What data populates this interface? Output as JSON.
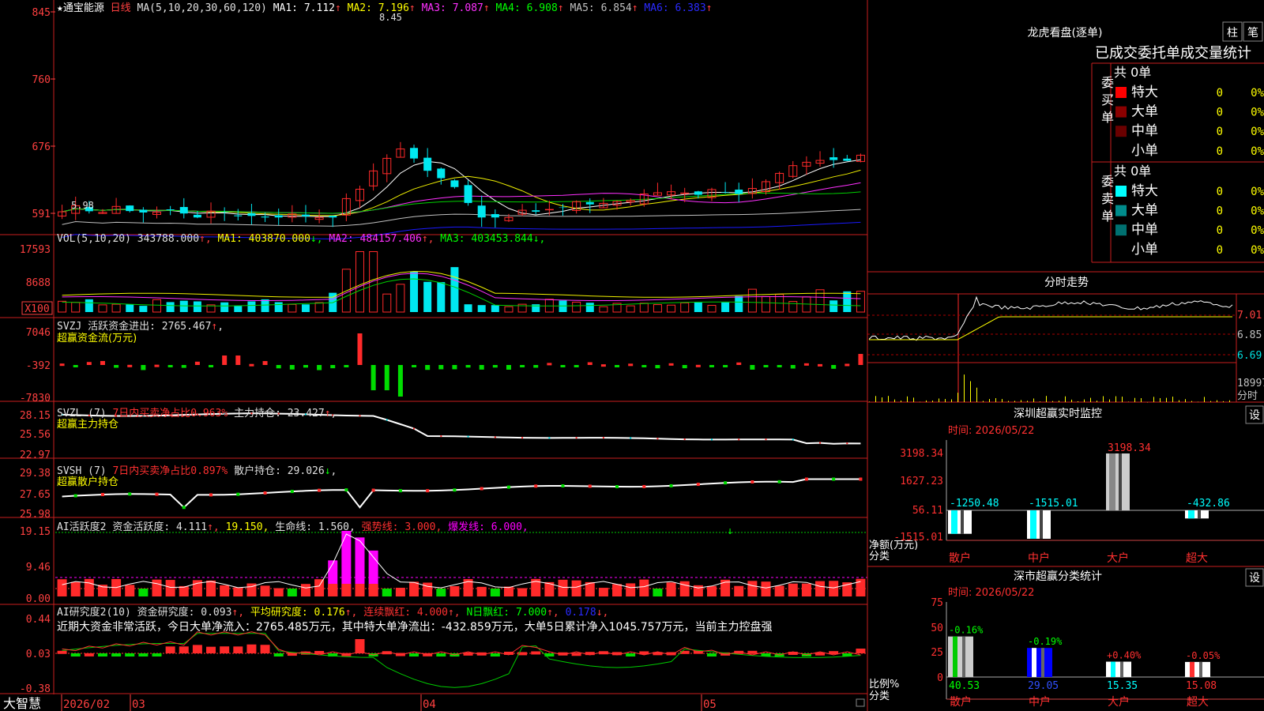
{
  "stock": {
    "star": "★",
    "name": "通宝能源",
    "period": "日线"
  },
  "colors": {
    "up": "#ff2a2a",
    "down": "#00e8f0",
    "axis_red": "#c81e1e",
    "ma1": "#ffffff",
    "ma2": "#f0f000",
    "ma3": "#ff30ff",
    "ma4": "#00d000",
    "ma5": "#c0c0c0",
    "ma6": "#1a1aff",
    "label_red": "#ff4040",
    "label_green": "#00ff00",
    "text_yellow": "#ffff00",
    "magenta": "#ff00ff"
  },
  "kline": {
    "header": {
      "ma_def": "MA(5,10,20,30,60,120)",
      "items": [
        {
          "label": "MA1: 7.112",
          "arrow": "↑",
          "color": "#ffffff"
        },
        {
          "label": "MA2: 7.196",
          "arrow": "↑",
          "color": "#ffff00"
        },
        {
          "label": "MA3: 7.087",
          "arrow": "↑",
          "color": "#ff30ff"
        },
        {
          "label": "MA4: 6.908",
          "arrow": "↑",
          "color": "#00ff00"
        },
        {
          "label": "MA5: 6.854",
          "arrow": "↑",
          "color": "#c0c0c0"
        },
        {
          "label": "MA6: 6.383",
          "arrow": "↑",
          "color": "#2a2aff"
        }
      ]
    },
    "axis_labels": [
      "845",
      "760",
      "676",
      "591"
    ],
    "annot_high": "8.45",
    "annot_low": "5.98"
  },
  "volume": {
    "header": {
      "def": "VOL(5,10,20)",
      "value": "343788.000",
      "value_arrow": "↑",
      "items": [
        {
          "label": "MA1: 403870.000",
          "arrow": "↓",
          "color": "#ffff00"
        },
        {
          "label": "MA2: 484157.406",
          "arrow": "↑",
          "color": "#ff30ff"
        },
        {
          "label": "MA3: 403453.844",
          "arrow": "↓",
          "color": "#00ff00"
        }
      ]
    },
    "axis_labels": [
      "17593",
      "8688"
    ],
    "unit": "X100"
  },
  "svzj": {
    "title": "SVZJ",
    "label": "活跃资金进出: 2765.467",
    "arrow": "↑",
    "suffix": ",",
    "subtitle": "超赢资金流(万元)",
    "axis_labels": [
      "7046",
      "-392",
      "-7830"
    ]
  },
  "svzl": {
    "title": "SVZL (7)",
    "note": "7日内买卖净占比0.963%",
    "label": "主力持仓: 23.427",
    "arrow": "↑",
    "suffix": ",",
    "subtitle": "超赢主力持仓",
    "axis_labels": [
      "28.15",
      "25.56",
      "22.97"
    ]
  },
  "svsh": {
    "title": "SVSH (7)",
    "note": "7日内买卖净占比0.897%",
    "label": "散户持仓: 29.026",
    "arrow": "↓",
    "suffix": ",",
    "subtitle": "超赢散户持仓",
    "axis_labels": [
      "29.38",
      "27.65",
      "25.98"
    ]
  },
  "ai_active": {
    "title": "AI活跃度2",
    "items": [
      {
        "label": "资金活跃度: 4.111",
        "arrow": "↑",
        "color": "#e0e0e0"
      },
      {
        "label": "19.150",
        "arrow": "",
        "color": "#ffff00"
      },
      {
        "label": "生命线: 1.560",
        "arrow": "",
        "color": "#e0e0e0"
      },
      {
        "label": "强势线: 3.000",
        "arrow": "",
        "color": "#ff3030"
      },
      {
        "label": "爆发线: 6.000",
        "arrow": "",
        "color": "#ff00ff"
      }
    ],
    "axis_labels": [
      "19.15",
      "9.46",
      "0.00"
    ]
  },
  "ai_research": {
    "title": "AI研究度2(10)",
    "items": [
      {
        "label": "资金研究度: 0.093",
        "arrow": "↑",
        "color": "#e0e0e0"
      },
      {
        "label": "平均研究度: 0.176",
        "arrow": "↑",
        "color": "#ffff00"
      },
      {
        "label": "连续飘红: 4.000",
        "arrow": "↑",
        "color": "#ff3030"
      },
      {
        "label": "N日飘红: 7.000",
        "arrow": "↑",
        "color": "#00ff00"
      },
      {
        "label": "0.178",
        "arrow": "↓",
        "color": "#2a2aff"
      }
    ],
    "summary": "近期大资金非常活跃，今日大单净流入：2765.485万元，其中特大单净流出：-432.859万元，大单5日累计净入1045.757万元，当前主力控盘强",
    "axis_labels": [
      "0.44",
      "0.03",
      "-0.38"
    ]
  },
  "date_axis": {
    "labels": [
      "2026/02",
      "03",
      "04",
      "05"
    ]
  },
  "footer": {
    "brand": "大智慧"
  },
  "dragon": {
    "title": "龙虎看盘(逐单)",
    "btn1": "柱",
    "btn2": "笔",
    "subtitle": "已成交委托单成交量统计",
    "buy": {
      "side": "委买单",
      "total": "共 0单",
      "rows": [
        {
          "label": "特大",
          "v": "0",
          "p": "0%",
          "color": "#ff0000"
        },
        {
          "label": "大单",
          "v": "0",
          "p": "0%",
          "color": "#8b0000"
        },
        {
          "label": "中单",
          "v": "0",
          "p": "0%",
          "color": "#6a0000"
        },
        {
          "label": "小单",
          "v": "0",
          "p": "0%",
          "color": ""
        }
      ]
    },
    "sell": {
      "side": "委卖单",
      "total": "共 0单",
      "rows": [
        {
          "label": "特大",
          "v": "0",
          "p": "0%",
          "color": "#00ffff"
        },
        {
          "label": "大单",
          "v": "0",
          "p": "0%",
          "color": "#008b8b"
        },
        {
          "label": "中单",
          "v": "0",
          "p": "0%",
          "color": "#007070"
        },
        {
          "label": "小单",
          "v": "0",
          "p": "0%",
          "color": ""
        }
      ]
    }
  },
  "intraday": {
    "title": "分时走势",
    "price_labels": [
      "7.01",
      "6.85",
      "6.69"
    ],
    "volume_label": "18997",
    "volume_unit": "分时"
  },
  "sz_monitor": {
    "title": "深圳超赢实时监控",
    "btn": "设",
    "time": "时间: 2026/05/22",
    "axis_labels": [
      "3198.34",
      "1627.23",
      "56.11",
      "-1515.01"
    ],
    "y_title": "净额(万元)",
    "x_title": "分类",
    "chart_data": {
      "type": "bar",
      "categories": [
        "散户",
        "中户",
        "大户",
        "超大"
      ],
      "values": [
        -1250.48,
        -1515.01,
        3198.34,
        -432.86
      ],
      "value_labels": [
        "-1250.48",
        "-1515.01",
        "3198.34",
        "-432.86"
      ],
      "ylim": [
        -1515.01,
        3198.34
      ]
    }
  },
  "sz_class": {
    "title": "深市超赢分类统计",
    "btn": "设",
    "time": "时间: 2026/05/22",
    "axis_labels": [
      "75",
      "50",
      "25",
      "0"
    ],
    "y_title": "比例%",
    "x_title": "分类",
    "chart_data": {
      "type": "bar",
      "categories": [
        "散户",
        "中户",
        "大户",
        "超大"
      ],
      "values": [
        40.53,
        29.05,
        15.35,
        15.08
      ],
      "value_labels": [
        "40.53",
        "29.05",
        "15.35",
        "15.08"
      ],
      "changes": [
        "-0.16%",
        "-0.19%",
        "+0.40%",
        "-0.05%"
      ],
      "ylim": [
        0,
        75
      ]
    }
  }
}
